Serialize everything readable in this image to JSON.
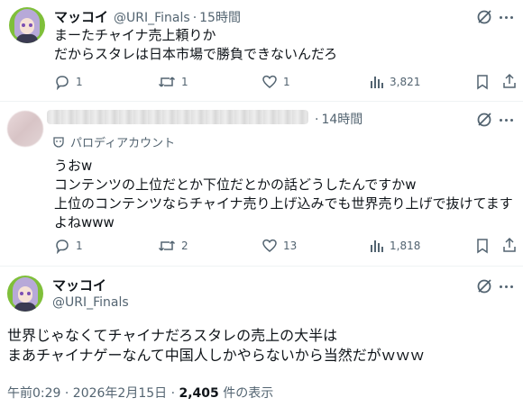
{
  "tweet1": {
    "name": "マッコイ",
    "handle": "@URI_Finals",
    "time": "15時間",
    "text": "まーたチャイナ売上頼りか\nだからスタレは日本市場で勝負できないんだろ",
    "replies": "1",
    "retweets": "1",
    "likes": "1",
    "views": "3,821"
  },
  "tweet2": {
    "time": "14時間",
    "parody_label": "パロディアカウント",
    "text": "うおw\nコンテンツの上位だとか下位だとかの話どうしたんですかw\n上位のコンテンツならチャイナ売り上げ込みでも世界売り上げで抜けてます\nよねwww",
    "replies": "1",
    "retweets": "2",
    "likes": "13",
    "views": "1,818"
  },
  "tweet3": {
    "name": "マッコイ",
    "handle": "@URI_Finals",
    "text": "世界じゃなくてチャイナだろスタレの売上の大半は\nまあチャイナゲーなんて中国人しかやらないから当然だがｗｗｗ",
    "timestamp": "午前0:29 · 2026年2月15日 · ",
    "view_count": "2,405",
    "view_suffix": " 件の表示"
  }
}
